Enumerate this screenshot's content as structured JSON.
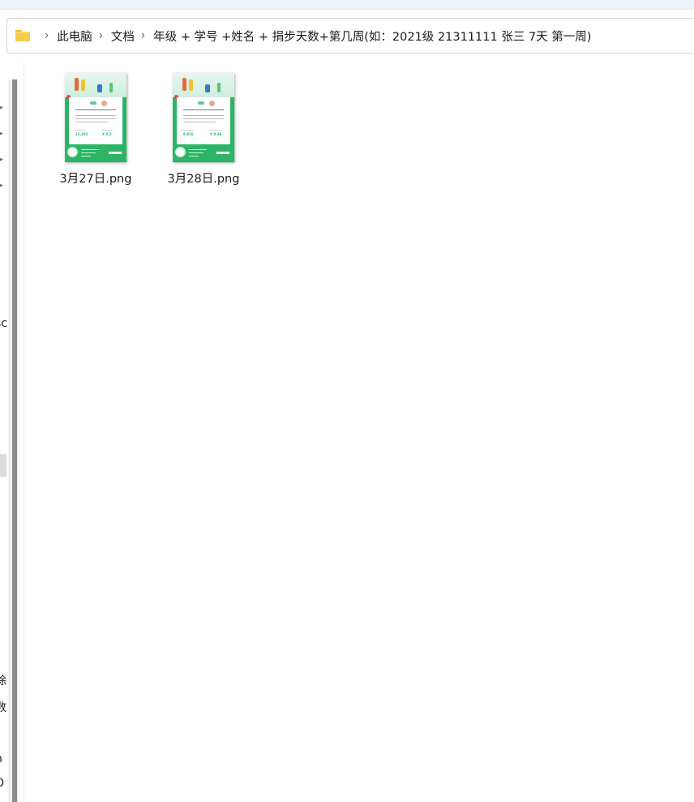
{
  "address_bar": {
    "crumbs": [
      "此电脑",
      "文档",
      "年级 + 学号 +姓名 + 捐步天数+第几周(如：2021级 21311111 张三  7天 第一周)"
    ]
  },
  "nav_pane": {
    "partial_labels": [
      "sc",
      "除",
      "数",
      "n",
      "O"
    ]
  },
  "files": [
    {
      "name": "3月27日.png",
      "thumb": {
        "name_line": "睿睿宝 . Seiee",
        "steps": "11,201",
        "rank": "X 0.3"
      }
    },
    {
      "name": "3月28日.png",
      "thumb": {
        "name_line": "睿睿宝 . Seiee",
        "steps": "9,816",
        "rank": "X 0.36"
      }
    }
  ],
  "colors": {
    "thumb_green": "#2bb565",
    "folder_yellow": "#f8cc4a"
  },
  "icons": [
    "folder-icon",
    "chevron-right-icon",
    "expand-arrow-icon"
  ]
}
